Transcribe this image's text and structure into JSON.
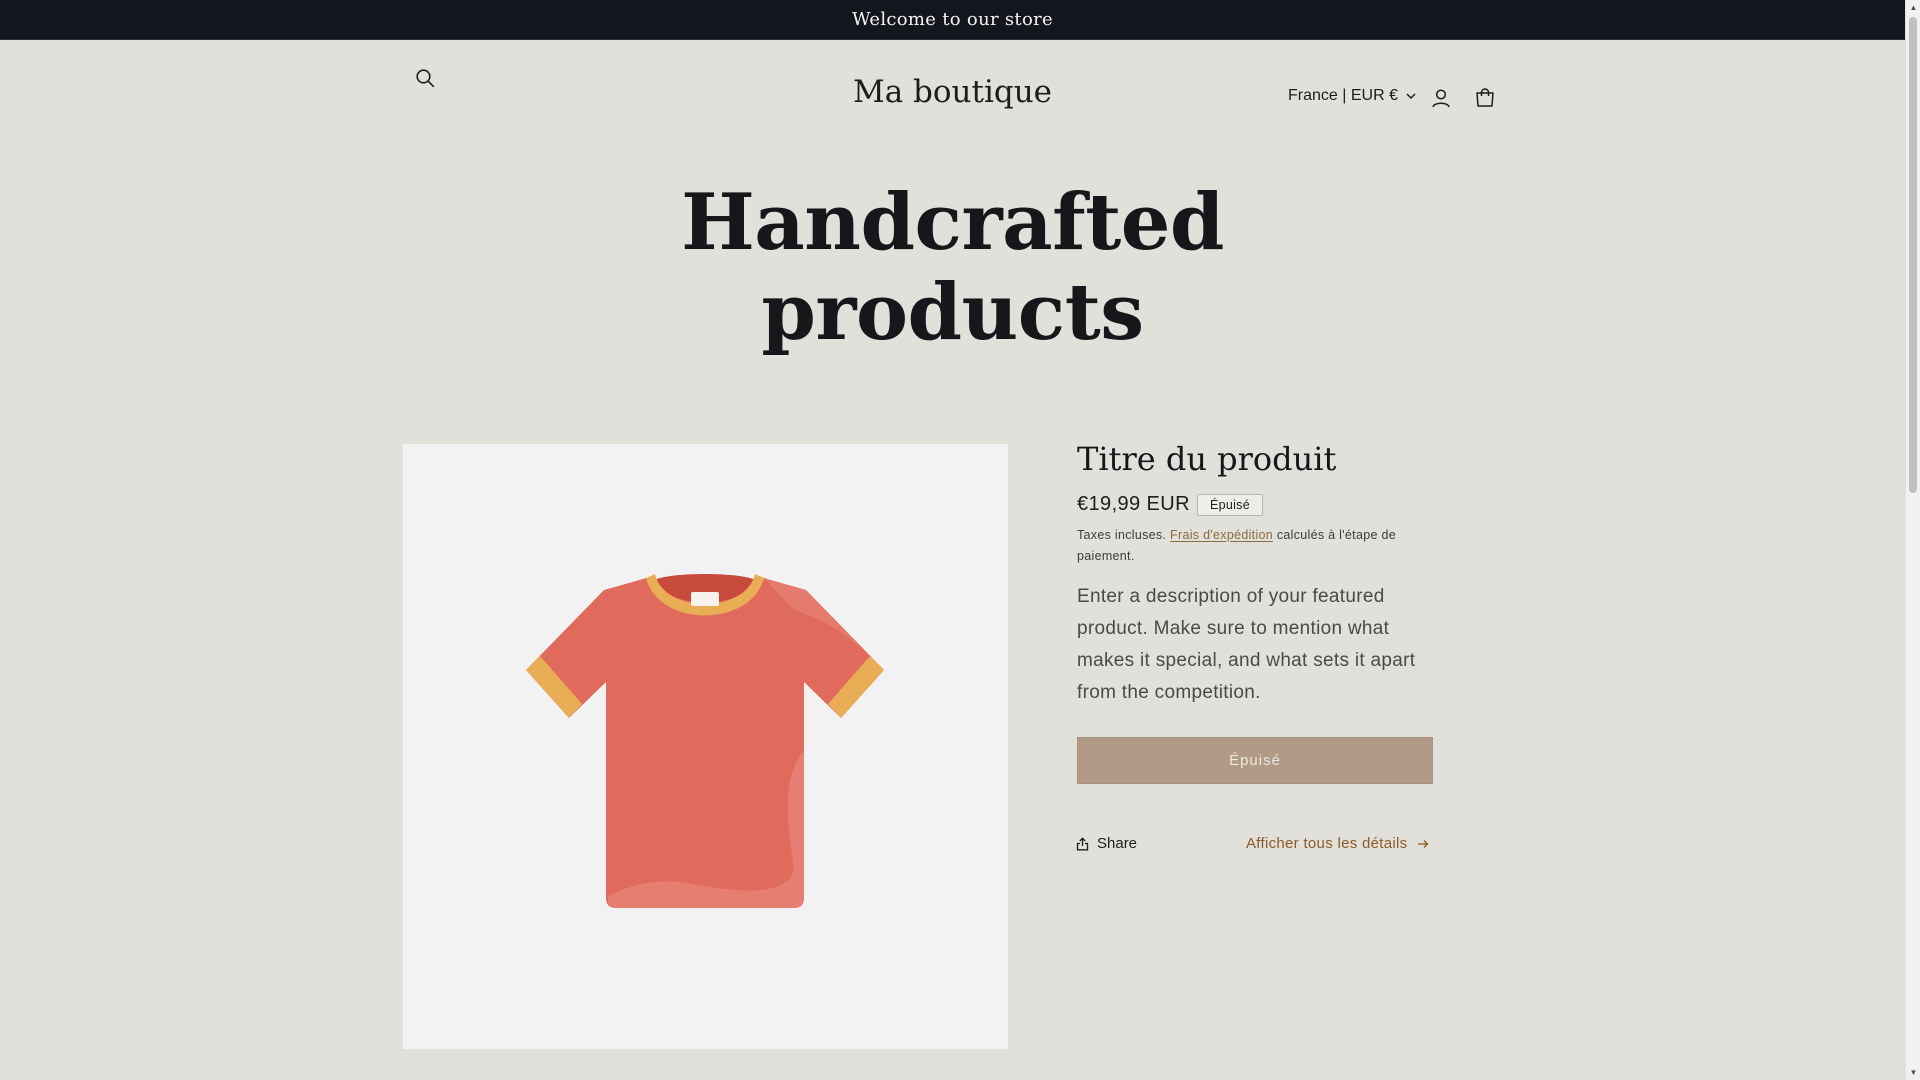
{
  "announcement": {
    "text": "Welcome to our store"
  },
  "header": {
    "logo": "Ma boutique",
    "country_selector": "France | EUR €",
    "icons": [
      "search-icon",
      "account-icon",
      "cart-icon"
    ]
  },
  "hero": {
    "title_line1": "Handcrafted",
    "title_line2": "products"
  },
  "product": {
    "title": "Titre du produit",
    "price": "€19,99 EUR",
    "badge": "Épuisé",
    "tax_prefix": "Taxes incluses.",
    "tax_link": "Frais d'expédition",
    "tax_suffix": "calculés à l'étape de paiement.",
    "description": "Enter a description of your featured product. Make sure to mention what makes it special, and what sets it apart from the competition.",
    "button_label": "Épuisé",
    "share_label": "Share",
    "details_link": "Afficher tous les détails"
  },
  "colors": {
    "page_bg": "#e1e0da",
    "announcement_bg": "#13161d",
    "button_bg": "#b29b86",
    "link": "#8d5b26",
    "shirt": "#e06b5c",
    "shirt_trim": "#e9ad55"
  }
}
